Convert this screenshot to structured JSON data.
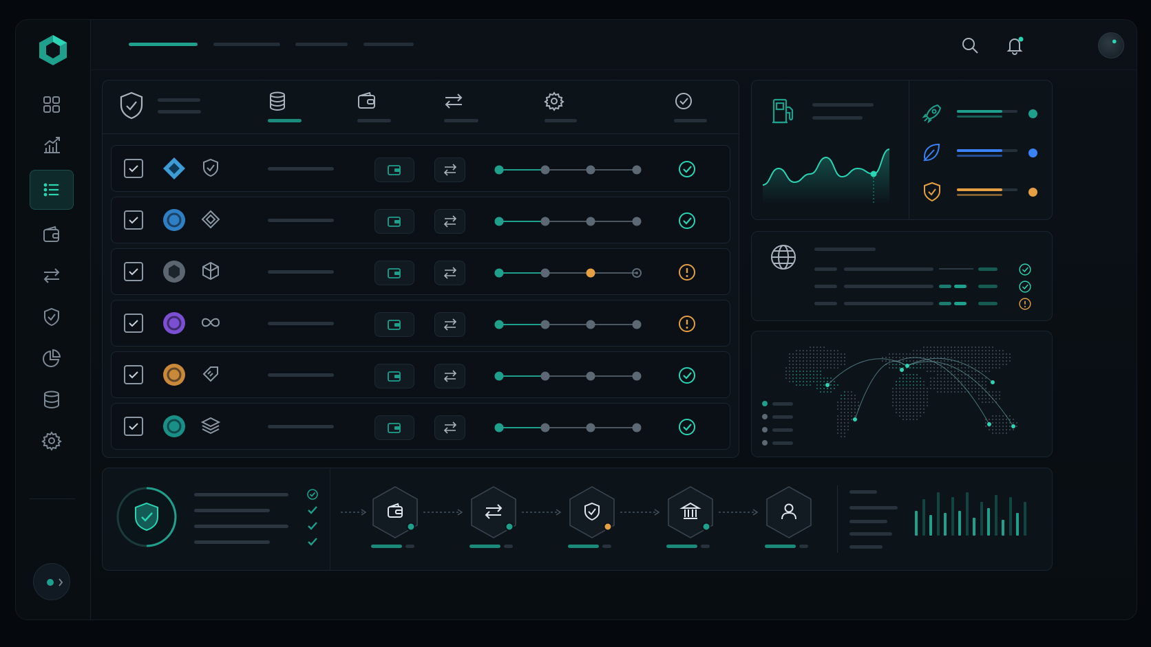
{
  "theme": {
    "accent": "#1fa08d",
    "accent_bright": "#2bd4b3",
    "warning": "#e4a043",
    "info": "#3b82f6",
    "background": "#05080c",
    "panel": "#0c1319"
  },
  "sidebar": {
    "logo": "hexagon-logo",
    "items": [
      {
        "icon": "grid-icon",
        "active": false
      },
      {
        "icon": "chart-icon",
        "active": false
      },
      {
        "icon": "list-icon",
        "active": true
      },
      {
        "icon": "wallet-icon",
        "active": false
      },
      {
        "icon": "transfer-icon",
        "active": false
      },
      {
        "icon": "shield-icon",
        "active": false
      },
      {
        "icon": "pie-icon",
        "active": false
      },
      {
        "icon": "database-icon",
        "active": false
      },
      {
        "icon": "settings-icon",
        "active": false
      }
    ]
  },
  "topbar": {
    "tabs": [
      {
        "active": true
      },
      {
        "active": false
      },
      {
        "active": false
      },
      {
        "active": false
      }
    ],
    "icons": [
      "search-icon",
      "bell-icon",
      "avatar"
    ]
  },
  "table": {
    "header_icons": [
      "shield-check-icon",
      "database-icon",
      "wallet-icon",
      "transfer-icon",
      "settings-icon",
      "check-circle-icon"
    ],
    "rows": [
      {
        "token_icon": "diamond-token-icon",
        "token_color": "#3d9bd6",
        "network_icon": "shield-check-icon",
        "progress_steps": 4,
        "warn_step": null,
        "status": "ok"
      },
      {
        "token_icon": "circle-token-icon",
        "token_color": "#2f7fc4",
        "network_icon": "diamond-outline-icon",
        "progress_steps": 4,
        "warn_step": null,
        "status": "ok"
      },
      {
        "token_icon": "hex-token-icon",
        "token_color": "#5b6670",
        "network_icon": "cube-icon",
        "progress_steps": 4,
        "warn_step": 3,
        "status": "warning"
      },
      {
        "token_icon": "circle-token-icon",
        "token_color": "#7b4fd1",
        "network_icon": "infinity-icon",
        "progress_steps": 4,
        "warn_step": null,
        "status": "warning"
      },
      {
        "token_icon": "circle-token-icon",
        "token_color": "#c9893a",
        "network_icon": "tag-icon",
        "progress_steps": 4,
        "warn_step": null,
        "status": "ok"
      },
      {
        "token_icon": "circle-token-icon",
        "token_color": "#1a8f87",
        "network_icon": "layers-icon",
        "progress_steps": 4,
        "warn_step": null,
        "status": "ok"
      }
    ]
  },
  "gas_panel": {
    "icon": "fuel-pump-icon",
    "series": [
      0.25,
      0.55,
      0.3,
      0.45,
      0.75,
      0.4,
      0.55,
      0.45,
      0.9
    ],
    "highlight_index": 7
  },
  "speed_panel": {
    "items": [
      {
        "icon": "rocket-icon",
        "color": "#1fa08d",
        "level": 0.75
      },
      {
        "icon": "leaf-icon",
        "color": "#3b82f6",
        "level": 0.75
      },
      {
        "icon": "shield-icon",
        "color": "#e4a043",
        "level": 0.75
      }
    ]
  },
  "network_panel": {
    "icon": "globe-icon",
    "statuses": [
      "ok",
      "ok",
      "warning"
    ]
  },
  "map_panel": {
    "legend_count": 4
  },
  "flow": {
    "steps": [
      {
        "icon": "wallet-icon",
        "status": "ok"
      },
      {
        "icon": "transfer-icon",
        "status": "ok"
      },
      {
        "icon": "shield-check-icon",
        "status": "warning"
      },
      {
        "icon": "bank-icon",
        "status": "ok"
      },
      {
        "icon": "user-icon",
        "status": "none"
      }
    ],
    "checks": [
      "ok",
      "ok",
      "ok",
      "ok"
    ],
    "bars": [
      0.55,
      0.8,
      0.45,
      0.95,
      0.5,
      0.85,
      0.55,
      0.95,
      0.4,
      0.75,
      0.6,
      0.9,
      0.35,
      0.85,
      0.5,
      0.75
    ]
  }
}
